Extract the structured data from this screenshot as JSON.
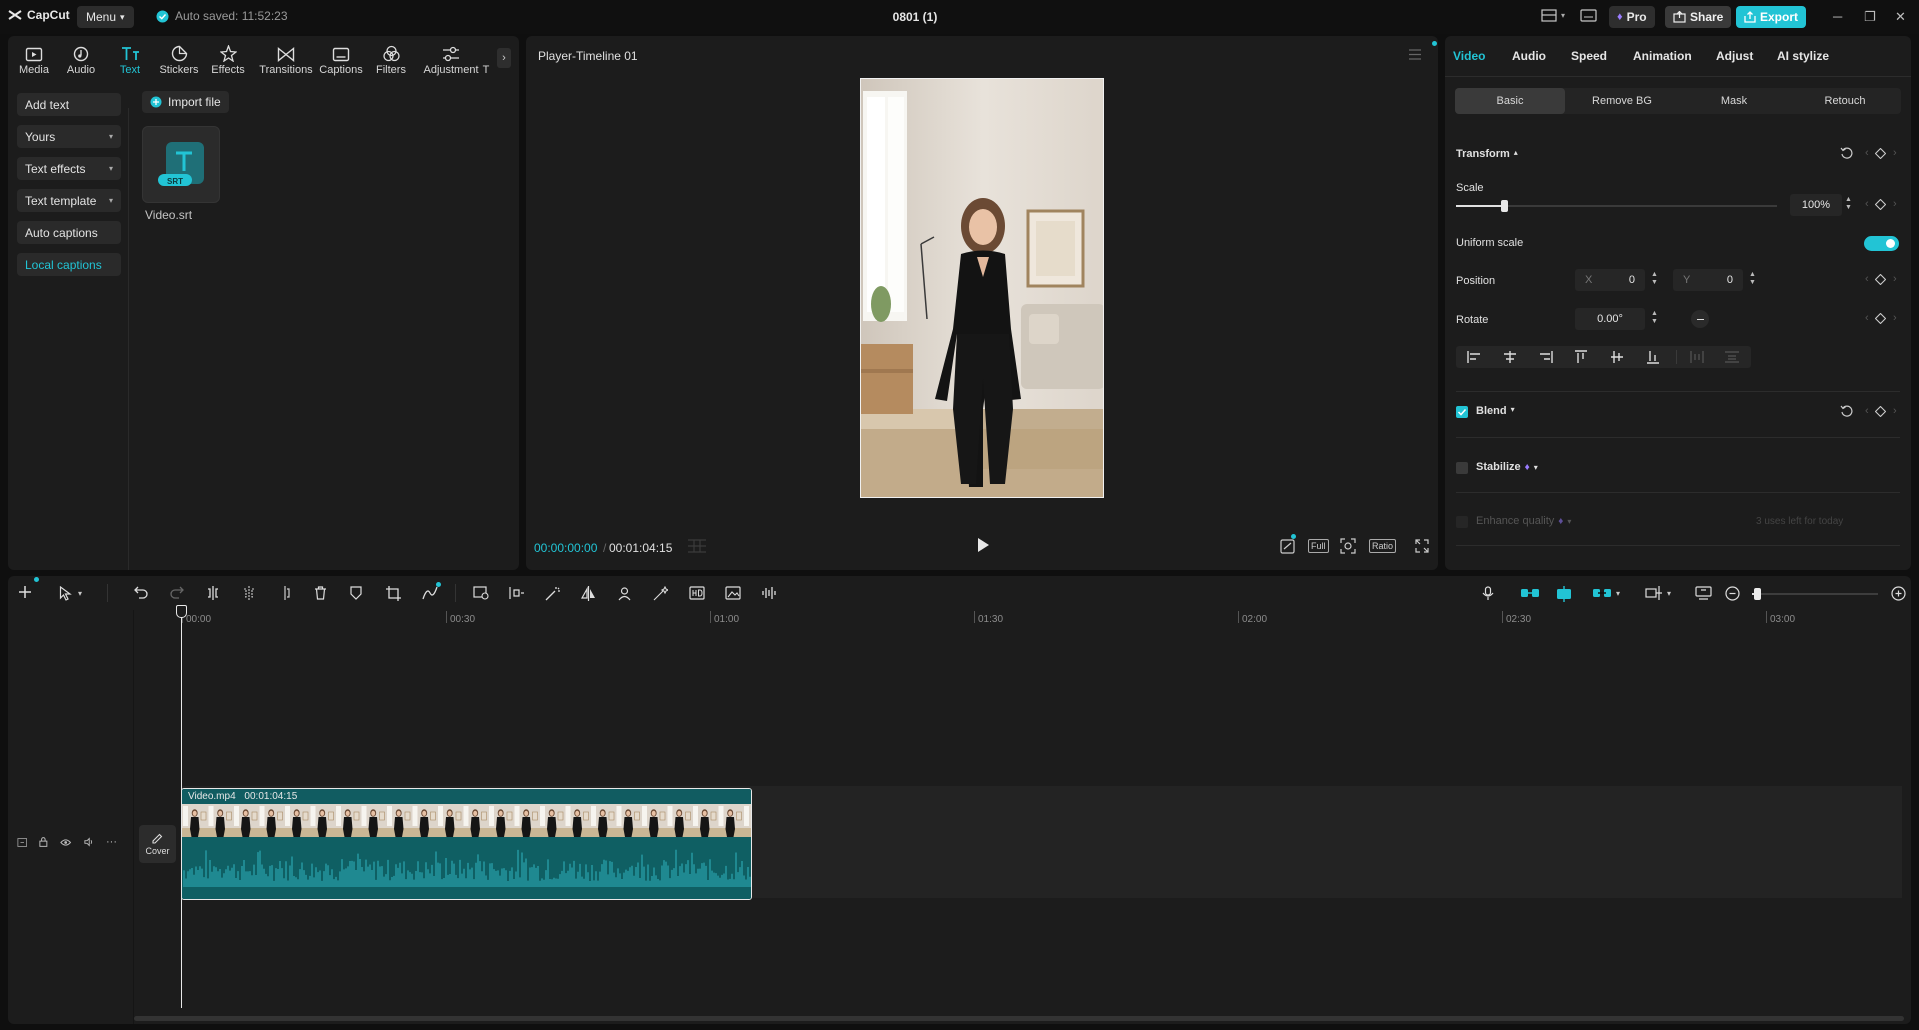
{
  "titlebar": {
    "app_name": "CapCut",
    "menu_label": "Menu",
    "autosave_text": "Auto saved: 11:52:23",
    "project_title": "0801 (1)",
    "pro_label": "Pro",
    "share_label": "Share",
    "export_label": "Export"
  },
  "left": {
    "tools": [
      {
        "label": "Media",
        "icon": "media-icon"
      },
      {
        "label": "Audio",
        "icon": "audio-icon"
      },
      {
        "label": "Text",
        "icon": "text-icon"
      },
      {
        "label": "Stickers",
        "icon": "stickers-icon"
      },
      {
        "label": "Effects",
        "icon": "effects-icon"
      },
      {
        "label": "Transitions",
        "icon": "transitions-icon"
      },
      {
        "label": "Captions",
        "icon": "captions-icon"
      },
      {
        "label": "Filters",
        "icon": "filters-icon"
      },
      {
        "label": "Adjustment",
        "icon": "adjustment-icon"
      },
      {
        "label": "T",
        "icon": "templates-icon"
      }
    ],
    "active_tool": "Text",
    "submenu": [
      "Add text",
      "Yours",
      "Text effects",
      "Text template",
      "Auto captions",
      "Local captions"
    ],
    "active_submenu": "Local captions",
    "import_label": "Import file",
    "file": {
      "name": "Video.srt",
      "badge": "SRT"
    }
  },
  "player": {
    "title": "Player-Timeline 01",
    "time_current": "00:00:00:00",
    "time_total": "00:01:04:15",
    "full_label": "Full",
    "ratio_label": "Ratio"
  },
  "right": {
    "tabs": [
      "Video",
      "Audio",
      "Speed",
      "Animation",
      "Adjust",
      "AI stylize"
    ],
    "active_tab": "Video",
    "subtabs": [
      "Basic",
      "Remove BG",
      "Mask",
      "Retouch"
    ],
    "active_subtab": "Basic",
    "transform_label": "Transform",
    "scale_label": "Scale",
    "scale_value": "100%",
    "scale_level": 0.15,
    "uniform_scale_label": "Uniform scale",
    "uniform_scale_on": true,
    "position_label": "Position",
    "pos_x_label": "X",
    "pos_x": "0",
    "pos_y_label": "Y",
    "pos_y": "0",
    "rotate_label": "Rotate",
    "rotate_value": "0.00°",
    "blend_label": "Blend",
    "stabilize_label": "Stabilize",
    "enhance_label": "Enhance quality",
    "enhance_note": "3 uses left for today"
  },
  "timeline": {
    "ruler": [
      "00:00",
      "00:30",
      "01:00",
      "01:30",
      "02:00",
      "02:30",
      "03:00"
    ],
    "clip_name": "Video.mp4",
    "clip_duration": "00:01:04:15",
    "cover_label": "Cover"
  },
  "colors": {
    "accent": "#22c4d5",
    "clip": "#0f5f63",
    "pro_purple": "#9a7cff"
  }
}
